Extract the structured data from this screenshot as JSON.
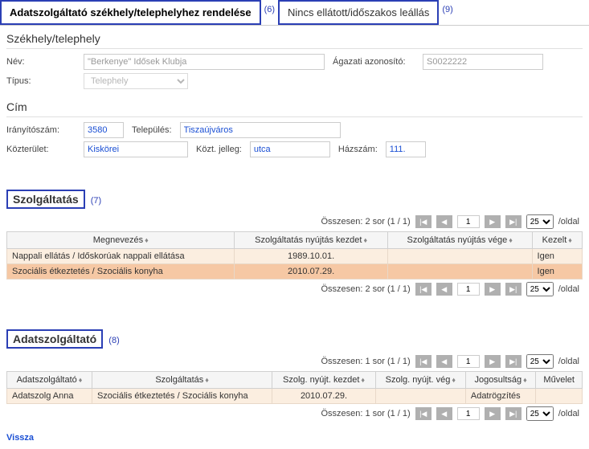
{
  "tabs": {
    "active": "Adatszolgáltató székhely/telephelyhez rendelése",
    "inactive": "Nincs ellátott/időszakos leállás",
    "annot_active": "(6)",
    "annot_inactive": "(9)"
  },
  "szekhely": {
    "title": "Székhely/telephely",
    "nev_label": "Név:",
    "nev_value": "\"Berkenye\" Idősek Klubja",
    "agazati_label": "Ágazati azonosító:",
    "agazati_value": "S0022222",
    "tipus_label": "Típus:",
    "tipus_value": "Telephely"
  },
  "cim": {
    "title": "Cím",
    "irsz_label": "Irányítószám:",
    "irsz_value": "3580",
    "telepules_label": "Település:",
    "telepules_value": "Tiszaújváros",
    "kozterulet_label": "Közterület:",
    "kozterulet_value": "Kiskörei",
    "koztjelleg_label": "Közt. jelleg:",
    "koztjelleg_value": "utca",
    "hazszam_label": "Házszám:",
    "hazszam_value": "111."
  },
  "szolgaltatas": {
    "title": "Szolgáltatás",
    "annot": "(7)",
    "pager_summary": "Összesen: 2 sor (1 / 1)",
    "page": "1",
    "page_size": "25",
    "per_page_suffix": "/oldal",
    "headers": {
      "megnevezes": "Megnevezés",
      "kezdet": "Szolgáltatás nyújtás kezdet",
      "vege": "Szolgáltatás nyújtás vége",
      "kezelt": "Kezelt"
    },
    "rows": [
      {
        "megnevezes": "Nappali ellátás / Időskorúak nappali ellátása",
        "kezdet": "1989.10.01.",
        "vege": "",
        "kezelt": "Igen"
      },
      {
        "megnevezes": "Szociális étkeztetés / Szociális konyha",
        "kezdet": "2010.07.29.",
        "vege": "",
        "kezelt": "Igen"
      }
    ]
  },
  "adatszolgaltato": {
    "title": "Adatszolgáltató",
    "annot": "(8)",
    "pager_summary": "Összesen: 1 sor (1 / 1)",
    "page": "1",
    "page_size": "25",
    "per_page_suffix": "/oldal",
    "headers": {
      "adatszolg": "Adatszolgáltató",
      "szolg": "Szolgáltatás",
      "kezdet": "Szolg. nyújt. kezdet",
      "vege": "Szolg. nyújt. vég",
      "jogosultsag": "Jogosultság",
      "muvelet": "Művelet"
    },
    "rows": [
      {
        "adatszolg": "Adatszolg Anna",
        "szolg": "Szociális étkeztetés / Szociális konyha",
        "kezdet": "2010.07.29.",
        "vege": "",
        "jogosultsag": "Adatrögzítés",
        "muvelet": ""
      }
    ]
  },
  "back": "Vissza",
  "icons": {
    "first": "|◀",
    "prev": "◀",
    "next": "▶",
    "last": "▶|",
    "sort": "♦"
  }
}
